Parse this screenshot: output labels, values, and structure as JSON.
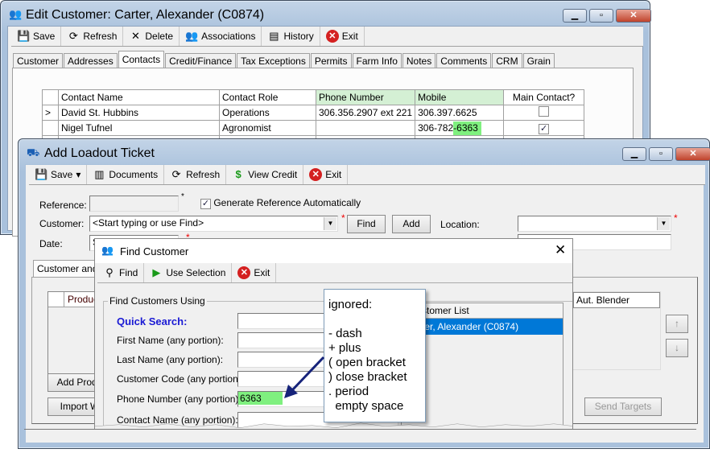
{
  "edit_customer": {
    "title": "Edit Customer: Carter, Alexander (C0874)",
    "toolbar": [
      {
        "label": "Save",
        "icon": "floppy-save-icon"
      },
      {
        "label": "Refresh",
        "icon": "refresh-icon"
      },
      {
        "label": "Delete",
        "icon": "x-delete-icon"
      },
      {
        "label": "Associations",
        "icon": "people-icon"
      },
      {
        "label": "History",
        "icon": "history-icon"
      },
      {
        "label": "Exit",
        "icon": "exit-icon"
      }
    ],
    "tabs": [
      "Customer",
      "Addresses",
      "Contacts",
      "Credit/Finance",
      "Tax Exceptions",
      "Permits",
      "Farm Info",
      "Notes",
      "Comments",
      "CRM",
      "Grain"
    ],
    "active_tab": "Contacts",
    "grid": {
      "headers": [
        "Contact Name",
        "Contact Role",
        "Phone Number",
        "Mobile",
        "Main Contact?"
      ],
      "rows": [
        {
          "indicator": ">",
          "name": "David St. Hubbins",
          "role": "Operations",
          "phone": "306.356.2907 ext 221",
          "mobile": "306.397.6625",
          "main": false
        },
        {
          "indicator": "",
          "name": "Nigel Tufnel",
          "role": "Agronomist",
          "phone": "",
          "mobile_prefix": "306-782",
          "mobile_match": "-6363",
          "main": true
        }
      ]
    },
    "highlight_color": "#7ff07f",
    "header_highlight_color": "#d4f0d4"
  },
  "loadout": {
    "title": "Add Loadout Ticket",
    "toolbar": [
      {
        "label": "Save",
        "icon": "floppy-save-icon"
      },
      {
        "label": "Documents",
        "icon": "documents-icon"
      },
      {
        "label": "Refresh",
        "icon": "refresh-icon"
      },
      {
        "label": "View Credit",
        "icon": "dollar-icon"
      },
      {
        "label": "Exit",
        "icon": "exit-icon"
      }
    ],
    "reference_label": "Reference:",
    "reference_value": "",
    "generate_ref_label": "Generate Reference Automatically",
    "generate_ref_checked": true,
    "customer_label": "Customer:",
    "customer_placeholder": "<Start typing or use Find>",
    "find_label": "Find",
    "add_label": "Add",
    "location_label": "Location:",
    "date_label": "Date:",
    "date_value": "S",
    "tab": "Customer and S",
    "products_header": "Produc",
    "add_product": "Add Produ",
    "import": "Import W",
    "blender_header": "Aut. Blender",
    "up": "↑",
    "down": "↓",
    "send_targets": "Send Targets"
  },
  "find_customer": {
    "title": "Find Customer",
    "toolbar": [
      {
        "label": "Find",
        "icon": "binoculars-icon"
      },
      {
        "label": "Use Selection",
        "icon": "play-arrow-icon"
      },
      {
        "label": "Exit",
        "icon": "exit-icon"
      }
    ],
    "group_label": "Find Customers Using",
    "fields": [
      {
        "label": "Quick Search:",
        "value": ""
      },
      {
        "label": "First Name (any portion):",
        "value": ""
      },
      {
        "label": "Last Name (any portion):",
        "value": ""
      },
      {
        "label": "Customer Code (any portion):",
        "value": ""
      },
      {
        "label": "Phone Number (any portion):",
        "value": "6363"
      },
      {
        "label": "Contact Name (any portion):",
        "value": ""
      }
    ],
    "list_header": "stomer List",
    "list_items": [
      "ter, Alexander (C0874)"
    ],
    "selection_color": "#0078d7"
  },
  "callout": {
    "lines": [
      "ignored:",
      "",
      "- dash",
      "+ plus",
      "( open bracket",
      ") close bracket",
      ". period",
      "  empty space"
    ]
  }
}
